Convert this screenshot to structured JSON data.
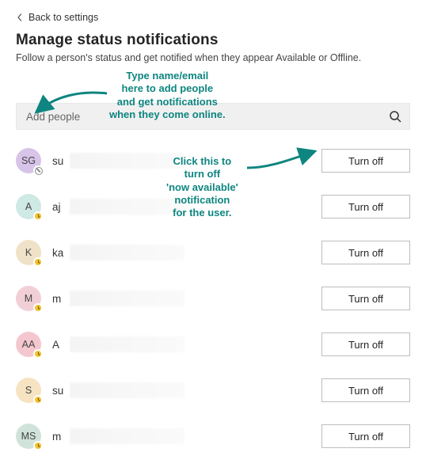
{
  "back_link": "Back to settings",
  "title": "Manage status notifications",
  "subtitle": "Follow a person's status and get notified when they appear Available or Offline.",
  "search": {
    "placeholder": "Add people"
  },
  "turn_off_label": "Turn off",
  "annotations": {
    "add_people": "Type name/email\nhere to add people\nand get notifications\nwhen they come online.",
    "turn_off": "Click this to\nturn off\n'now available'\nnotification\nfor the user."
  },
  "people": [
    {
      "initials": "SG",
      "name_prefix": "su",
      "avatar_bg": "#d7c4e8",
      "presence": "offline"
    },
    {
      "initials": "A",
      "name_prefix": "aj",
      "avatar_bg": "#cfe9e5",
      "presence": "away"
    },
    {
      "initials": "K",
      "name_prefix": "ka",
      "avatar_bg": "#efe2c8",
      "presence": "away"
    },
    {
      "initials": "M",
      "name_prefix": "m",
      "avatar_bg": "#f2cfd7",
      "presence": "away"
    },
    {
      "initials": "AA",
      "name_prefix": "A",
      "avatar_bg": "#f4c7cf",
      "presence": "away"
    },
    {
      "initials": "S",
      "name_prefix": "su",
      "avatar_bg": "#f6e3c2",
      "presence": "away"
    },
    {
      "initials": "MS",
      "name_prefix": "m",
      "avatar_bg": "#d0e3db",
      "presence": "away"
    }
  ]
}
